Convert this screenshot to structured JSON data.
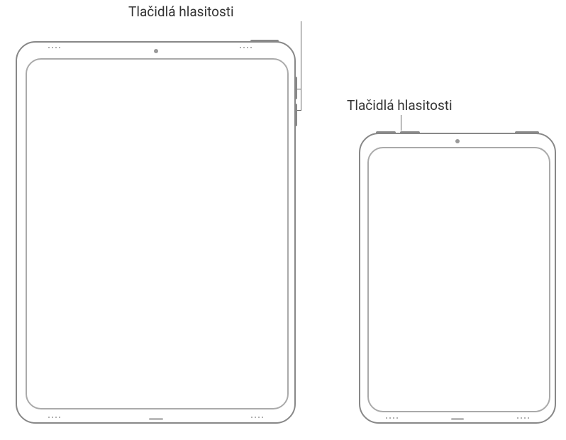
{
  "labels": {
    "left_volume": "Tlačidlá hlasitosti",
    "right_volume": "Tlačidlá hlasitosti"
  },
  "devices": {
    "left": {
      "name": "ipad-large",
      "volume_buttons_location": "right-side",
      "top_button_location": "top-right"
    },
    "right": {
      "name": "ipad-small",
      "volume_buttons_location": "top-left",
      "top_button_location": "top-right"
    }
  }
}
